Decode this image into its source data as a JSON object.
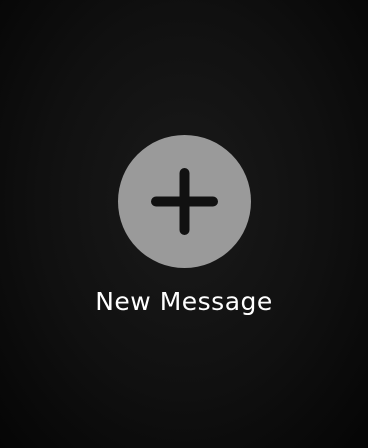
{
  "new_message": {
    "label": "New Message",
    "icon": "plus-icon",
    "circle_color": "#9a9a9a",
    "icon_color": "#111111"
  }
}
